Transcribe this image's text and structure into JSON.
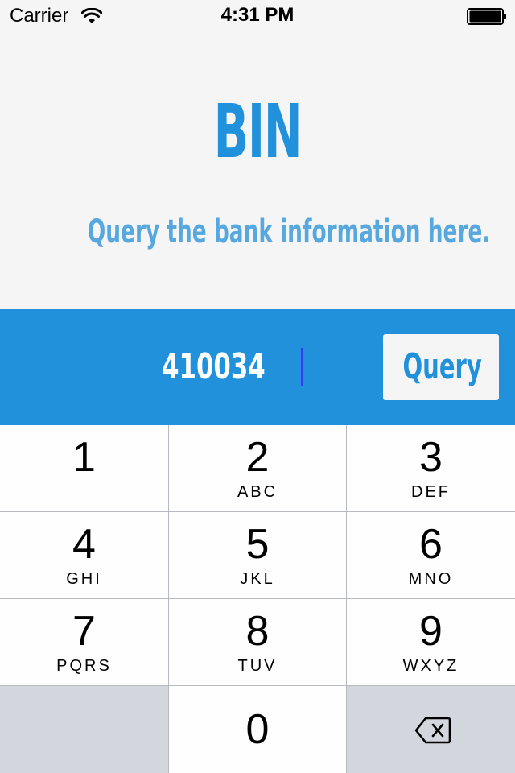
{
  "status_bar": {
    "carrier": "Carrier",
    "time": "4:31 PM",
    "wifi_icon": "wifi-icon",
    "battery_icon": "battery-icon"
  },
  "header": {
    "title": "BIN",
    "subtitle": "Query the bank information here."
  },
  "query": {
    "input_value": "410034",
    "button_label": "Query"
  },
  "keypad": {
    "keys": [
      {
        "digit": "1",
        "letters": ""
      },
      {
        "digit": "2",
        "letters": "ABC"
      },
      {
        "digit": "3",
        "letters": "DEF"
      },
      {
        "digit": "4",
        "letters": "GHI"
      },
      {
        "digit": "5",
        "letters": "JKL"
      },
      {
        "digit": "6",
        "letters": "MNO"
      },
      {
        "digit": "7",
        "letters": "PQRS"
      },
      {
        "digit": "8",
        "letters": "TUV"
      },
      {
        "digit": "9",
        "letters": "WXYZ"
      },
      {
        "digit": "0",
        "letters": ""
      }
    ],
    "delete_icon": "backspace-icon"
  },
  "colors": {
    "accent": "#2191db",
    "subtitle": "#57a8df",
    "background": "#f6f5f6",
    "key_background": "#fefefe",
    "key_grey": "#d4d6dd"
  }
}
